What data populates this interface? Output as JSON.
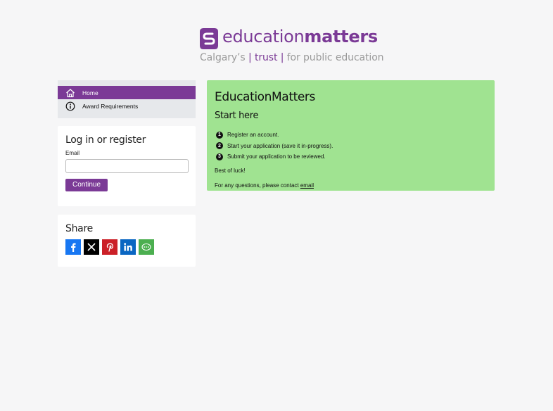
{
  "logo": {
    "word_light": "education",
    "word_bold": "matters",
    "tag_prefix": "Calgary’s",
    "tag_sep1": "|",
    "tag_trust": "trust",
    "tag_sep2": "|",
    "tag_suffix": "for public education"
  },
  "nav": {
    "items": [
      {
        "label": "Home",
        "icon": "home-icon",
        "active": true
      },
      {
        "label": "Award Requirements",
        "icon": "info-icon",
        "active": false
      }
    ]
  },
  "login": {
    "title": "Log in or register",
    "email_label": "Email",
    "email_value": "",
    "email_placeholder": "",
    "continue_label": "Continue"
  },
  "share": {
    "title": "Share",
    "buttons": [
      {
        "name": "facebook",
        "icon": "facebook-icon",
        "color": "#1877f2"
      },
      {
        "name": "x",
        "icon": "x-icon",
        "color": "#000000"
      },
      {
        "name": "pinterest",
        "icon": "pinterest-icon",
        "color": "#cb2027"
      },
      {
        "name": "linkedin",
        "icon": "linkedin-icon",
        "color": "#0a66c2"
      },
      {
        "name": "more",
        "icon": "more-icon",
        "color": "#4caf50"
      }
    ]
  },
  "main": {
    "title": "EducationMatters",
    "subtitle": "Start here",
    "steps": [
      {
        "num": "1",
        "text": "Register an account."
      },
      {
        "num": "2",
        "text": "Start your application (save it in-progress)."
      },
      {
        "num": "3",
        "text": "Submit your application to be reviewed."
      }
    ],
    "closing": "Best of luck!",
    "contact_prefix": "For any questions, please contact ",
    "contact_link": "email"
  },
  "colors": {
    "brand": "#7b3a96",
    "panel_green": "#a0e391",
    "nav_bg": "#e6e8eb",
    "page_bg": "#f6f6f7"
  }
}
